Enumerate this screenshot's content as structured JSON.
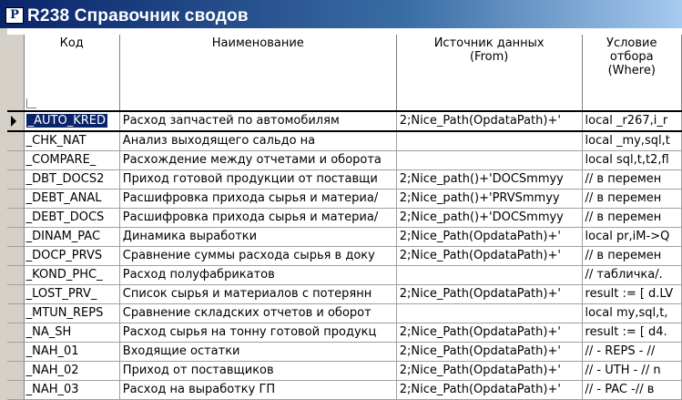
{
  "window": {
    "icon_glyph": "Р",
    "title": "R238 Справочник сводов"
  },
  "columns": [
    "Код",
    "Наименование",
    "Источник данных\n(From)",
    "Условие\nотбора\n(Where)"
  ],
  "rows": [
    {
      "code": "_AUTO_KRED",
      "name": "Расход запчастей по автомобилям",
      "from": "2;Nice_Path(OpdataPath)+'",
      "where": "local _r267,i_r"
    },
    {
      "code": "_CHK_NAT",
      "name": "Анализ выходящего сальдо на",
      "from": "",
      "where": "local _my,sql,t"
    },
    {
      "code": "_COMPARE_",
      "name": "Расхождение между отчетами и оборота",
      "from": "",
      "where": "local sql,t,t2,fl"
    },
    {
      "code": "_DBT_DOCS2",
      "name": "Приход готовой продукции от поставщи",
      "from": "2;Nice_path()+'DOCSmmyy",
      "where": "// в перемен"
    },
    {
      "code": "_DEBT_ANAL",
      "name": "Расшифровка прихода сырья и материа/",
      "from": "2;Nice_path()+'PRVSmmyy",
      "where": "// в перемен"
    },
    {
      "code": "_DEBT_DOCS",
      "name": "Расшифровка прихода сырья и материа/",
      "from": "2;Nice_path()+'DOCSmmyy",
      "where": "// в перемен"
    },
    {
      "code": "_DINAM_PAC",
      "name": "Динамика выработки",
      "from": "2;Nice_Path(OpdataPath)+'",
      "where": "local pr,iM->Q"
    },
    {
      "code": "_DOCP_PRVS",
      "name": "Сравнение суммы расхода сырья в доку",
      "from": "2;Nice_Path(OpdataPath)+'",
      "where": "// в перемен"
    },
    {
      "code": "_KOND_PHC_",
      "name": "Расход полуфабрикатов",
      "from": "",
      "where": "// табличка/."
    },
    {
      "code": "_LOST_PRV_",
      "name": "Список сырья и материалов с потерянн",
      "from": "2;Nice_Path(OpdataPath)+'",
      "where": "result := [ d.LV"
    },
    {
      "code": "_MTUN_REPS",
      "name": "Сравнение складских отчетов и оборот",
      "from": "",
      "where": "local my,sql,t,"
    },
    {
      "code": "_NA_SH",
      "name": "Расход сырья на тонну готовой продукц",
      "from": "2;Nice_Path(OpdataPath)+'",
      "where": "result := [ d4."
    },
    {
      "code": "_NAH_01",
      "name": "Входящие остатки",
      "from": "2;Nice_Path(OpdataPath)+'",
      "where": "// - REPS - //"
    },
    {
      "code": "_NAH_02",
      "name": "Приход от поставщиков",
      "from": "2;Nice_Path(OpdataPath)+'",
      "where": "// - UTH - // n"
    },
    {
      "code": "_NAH_03",
      "name": "Расход на выработку ГП",
      "from": "2;Nice_Path(OpdataPath)+'",
      "where": "// - PAC -// в"
    }
  ]
}
